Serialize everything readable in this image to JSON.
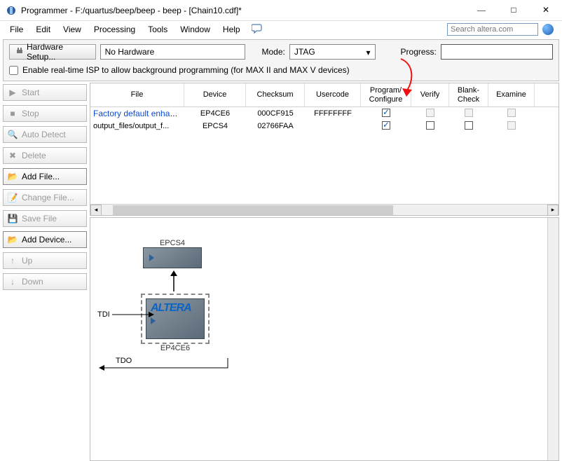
{
  "title": "Programmer - F:/quartus/beep/beep - beep - [Chain10.cdf]*",
  "menu": [
    "File",
    "Edit",
    "View",
    "Processing",
    "Tools",
    "Window",
    "Help"
  ],
  "search_placeholder": "Search altera.com",
  "hw_setup_btn": "Hardware Setup...",
  "hw_value": "No Hardware",
  "mode_label": "Mode:",
  "mode_value": "JTAG",
  "progress_label": "Progress:",
  "realtime_isp": "Enable real-time ISP to allow background programming (for MAX II and MAX V devices)",
  "sidebar": {
    "start": "Start",
    "stop": "Stop",
    "auto_detect": "Auto Detect",
    "delete": "Delete",
    "add_file": "Add File...",
    "change_file": "Change File...",
    "save_file": "Save File",
    "add_device": "Add Device...",
    "up": "Up",
    "down": "Down"
  },
  "columns": {
    "file": "File",
    "device": "Device",
    "checksum": "Checksum",
    "usercode": "Usercode",
    "program": "Program/\nConfigure",
    "verify": "Verify",
    "blank": "Blank-\nCheck",
    "examine": "Examine"
  },
  "rows": [
    {
      "file": "Factory default enhanced...",
      "link": true,
      "device": "EP4CE6",
      "checksum": "000CF915",
      "usercode": "FFFFFFFF",
      "program": true,
      "verify": null,
      "blank": null,
      "examine": null
    },
    {
      "file": "output_files/output_f...",
      "link": false,
      "device": "EPCS4",
      "checksum": "02766FAA",
      "usercode": "",
      "program": true,
      "verify": false,
      "blank": false,
      "examine": null
    }
  ],
  "diagram": {
    "epcs_label": "EPCS4",
    "main_label": "EP4CE6",
    "tdi": "TDI",
    "tdo": "TDO",
    "altera": "ALTERA"
  }
}
